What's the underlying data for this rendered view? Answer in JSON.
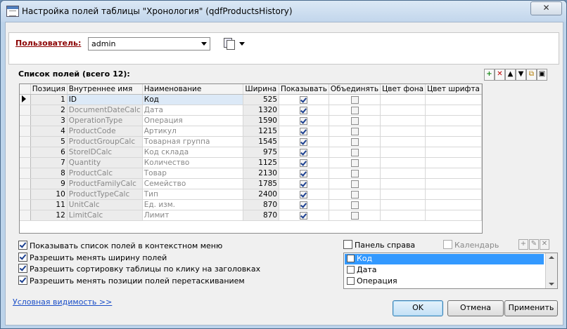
{
  "window": {
    "title": "Настройка полей таблицы \"Хронология\" (qdfProductsHistory)",
    "close": "✕"
  },
  "user": {
    "label": "Пользователь:",
    "value": "admin"
  },
  "fields": {
    "title": "Список полей (всего 12):",
    "toolbar": [
      "+",
      "✕",
      "▲",
      "▼",
      "⧉",
      "▣"
    ],
    "columns": [
      "Позиция",
      "Внутреннее имя",
      "Наименование",
      "Ширина",
      "Показывать",
      "Объединять",
      "Цвет фона",
      "Цвет шрифта"
    ],
    "rows": [
      {
        "pos": "1",
        "name": "ID",
        "title": "Код",
        "width": "525",
        "show": true,
        "merge": false
      },
      {
        "pos": "2",
        "name": "DocumentDateCalc",
        "title": "Дата",
        "width": "1320",
        "show": true,
        "merge": false
      },
      {
        "pos": "3",
        "name": "OperationType",
        "title": "Операция",
        "width": "1590",
        "show": true,
        "merge": false
      },
      {
        "pos": "4",
        "name": "ProductCode",
        "title": "Артикул",
        "width": "1215",
        "show": true,
        "merge": false
      },
      {
        "pos": "5",
        "name": "ProductGroupCalc",
        "title": "Товарная группа",
        "width": "1545",
        "show": true,
        "merge": false
      },
      {
        "pos": "6",
        "name": "StoreIDCalc",
        "title": "Код склада",
        "width": "975",
        "show": true,
        "merge": false
      },
      {
        "pos": "7",
        "name": "Quantity",
        "title": "Количество",
        "width": "1125",
        "show": true,
        "merge": false
      },
      {
        "pos": "8",
        "name": "ProductCalc",
        "title": "Товар",
        "width": "2130",
        "show": true,
        "merge": false
      },
      {
        "pos": "9",
        "name": "ProductFamilyCalc",
        "title": "Семейство",
        "width": "1785",
        "show": true,
        "merge": false
      },
      {
        "pos": "10",
        "name": "ProductTypeCalc",
        "title": "Тип",
        "width": "2400",
        "show": true,
        "merge": false
      },
      {
        "pos": "11",
        "name": "UnitCalc",
        "title": "Ед. изм.",
        "width": "870",
        "show": true,
        "merge": false
      },
      {
        "pos": "12",
        "name": "LimitCalc",
        "title": "Лимит",
        "width": "870",
        "show": true,
        "merge": false
      }
    ]
  },
  "options": [
    {
      "label": "Показывать список полей в контекстном меню",
      "checked": true
    },
    {
      "label": "Разрешить менять ширину полей",
      "checked": true
    },
    {
      "label": "Разрешить сортировку таблицы по клику на заголовках",
      "checked": true
    },
    {
      "label": "Разрешить менять позиции полей перетаскиванием",
      "checked": true
    }
  ],
  "right_panel": {
    "label": "Панель справа",
    "calendar_label": "Календарь",
    "toolbar": [
      "+",
      "✎",
      "✕"
    ]
  },
  "panel_list": [
    "Код",
    "Дата",
    "Операция"
  ],
  "links": {
    "conditional_visibility": "Условная видимость >>"
  },
  "buttons": {
    "ok": "OK",
    "cancel": "Отмена",
    "apply": "Применить"
  }
}
